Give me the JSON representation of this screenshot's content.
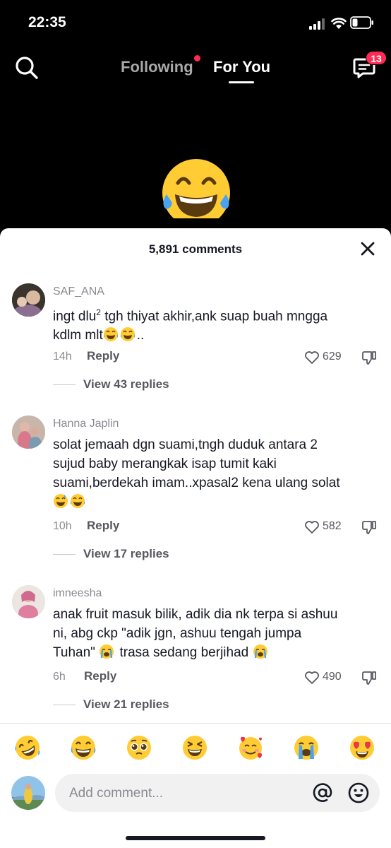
{
  "status_bar": {
    "time": "22:35"
  },
  "top_nav": {
    "following_label": "Following",
    "for_you_label": "For You",
    "inbox_badge": "13"
  },
  "sheet": {
    "comments_count": "5,891 comments"
  },
  "comments": [
    {
      "username": "SAF_ANA",
      "text_line1": "ingt dlu",
      "text_sup": "2",
      "text_line1b": " tgh thiyat akhir,ank suap buah mngga",
      "text_line2": "kdlm mlt",
      "text_line2_tail": "..",
      "time": "14h",
      "reply_label": "Reply",
      "likes": "629",
      "view_replies": "View 43 replies"
    },
    {
      "username": "Hanna Japlin",
      "text_line1": "solat jemaah dgn suami,tngh duduk antara 2",
      "text_line2": "sujud baby merangkak isap tumit kaki",
      "text_line3": "suami,berdekah imam..xpasal2 kena ulang solat",
      "time": "10h",
      "reply_label": "Reply",
      "likes": "582",
      "view_replies": "View 17 replies"
    },
    {
      "username": "imneesha",
      "text_line1": "anak fruit masuk bilik, adik dia nk terpa si ashuu",
      "text_line2": "ni, abg ckp \"adik jgn, ashuu tengah jumpa",
      "text_line3a": "Tuhan\" ",
      "text_line3b": " trasa sedang berjihad ",
      "time": "6h",
      "reply_label": "Reply",
      "likes": "490",
      "view_replies": "View 21 replies"
    }
  ],
  "quick_emojis": [
    "rofl-face",
    "joy-face",
    "pleading-face",
    "squinting-laugh-face",
    "smiling-hearts-face",
    "loudly-crying-face",
    "heart-eyes-face"
  ],
  "composer": {
    "placeholder": "Add comment..."
  },
  "colors": {
    "accent": "#fe2c55",
    "emoji_yellow": "#ffcc33",
    "text_primary": "#161823",
    "text_secondary": "#8a8b91"
  }
}
